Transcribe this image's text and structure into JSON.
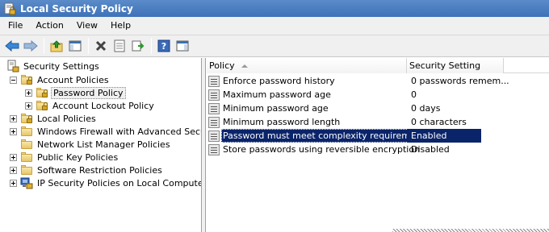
{
  "window": {
    "title": "Local Security Policy"
  },
  "menu": [
    "File",
    "Action",
    "View",
    "Help"
  ],
  "toolbar": {
    "buttons": [
      "back-icon",
      "forward-icon",
      "up-folder-icon",
      "show-hide-tree-icon",
      "delete-icon",
      "properties-icon",
      "export-list-icon",
      "help-icon",
      "show-action-pane-icon"
    ]
  },
  "tree": {
    "root": "Security Settings",
    "items": [
      {
        "label": "Account Policies"
      },
      {
        "label": "Password Policy"
      },
      {
        "label": "Account Lockout Policy"
      },
      {
        "label": "Local Policies"
      },
      {
        "label": "Windows Firewall with Advanced Security"
      },
      {
        "label": "Network List Manager Policies"
      },
      {
        "label": "Public Key Policies"
      },
      {
        "label": "Software Restriction Policies"
      },
      {
        "label": "IP Security Policies on Local Computer"
      }
    ]
  },
  "list": {
    "columns": {
      "policy": "Policy",
      "setting": "Security Setting"
    },
    "rows": [
      {
        "policy": "Enforce password history",
        "setting": "0 passwords remem..."
      },
      {
        "policy": "Maximum password age",
        "setting": "0"
      },
      {
        "policy": "Minimum password age",
        "setting": "0 days"
      },
      {
        "policy": "Minimum password length",
        "setting": "0 characters"
      },
      {
        "policy": "Password must meet complexity requirements",
        "setting": "Enabled"
      },
      {
        "policy": "Store passwords using reversible encryption",
        "setting": "Disabled"
      }
    ]
  },
  "colors": {
    "titlebar": "#3d72b8",
    "selection": "#0a246a",
    "folder": "#e8c668"
  }
}
